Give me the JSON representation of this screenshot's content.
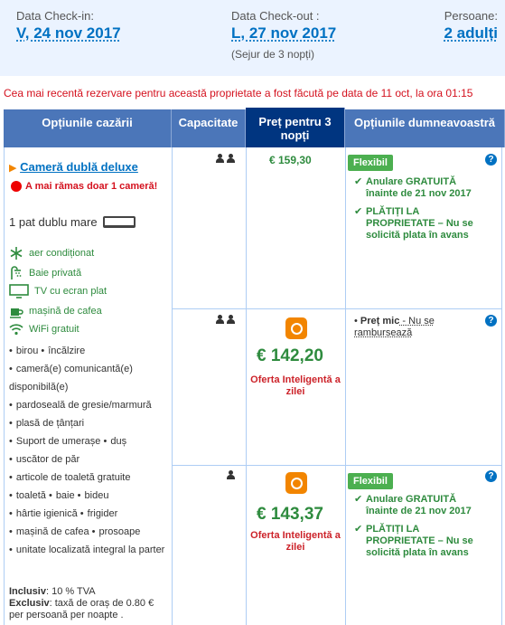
{
  "dates": {
    "checkin_label": "Data Check-in:",
    "checkin_value": "V, 24 nov 2017",
    "checkout_label": "Data Check-out :",
    "checkout_value": "L, 27 nov 2017",
    "stay_note": "(Sejur de 3 nopți)",
    "guests_label": "Persoane:",
    "guests_value": "2 adulți"
  },
  "notice": "Cea mai recentă rezervare pentru această proprietate a fost făcută pe data de 11 oct, la ora 01:15",
  "table": {
    "headers": [
      "Opțiunile cazării",
      "Capacitate",
      "Preț pentru 3 nopți",
      "Opțiunile dumneavoastră"
    ]
  },
  "room": {
    "name": "Cameră dublă deluxe",
    "alert": "A mai rămas doar 1 cameră!",
    "bed": "1 pat dublu mare",
    "amenities": [
      "aer condiționat",
      "Baie privată",
      "TV cu ecran plat",
      "mașină de cafea",
      "WiFi gratuit"
    ],
    "facilities": [
      "birou",
      "încălzire",
      "cameră(e) comunicantă(e) disponibilă(e)",
      "pardoseală de gresie/marmură",
      "plasă de țânțari",
      "Suport de umerașe",
      "duș",
      "uscător de păr",
      "articole de toaletă gratuite",
      "toaletă",
      "baie",
      "bideu",
      "hârtie igienică",
      "frigider",
      "mașină de cafea",
      "prosoape",
      "unitate localizată integral la parter"
    ],
    "included_label": "Inclusiv",
    "included_text": ": 10 % TVA",
    "excluded_label": "Exclusiv",
    "excluded_text": ": taxă de oraș de 0.80 € per persoană per noapte ."
  },
  "options": [
    {
      "persons": 2,
      "price": "€ 159,30",
      "badge": "Flexibil",
      "cond1_a": "Anulare GRATUITĂ",
      "cond1_b": "înainte de 21 nov 2017",
      "cond2_a": "PLĂTIȚI LA",
      "cond2_b": "PROPRIETATE",
      "cond2_c": " – Nu se solicită plata în avans"
    },
    {
      "persons": 2,
      "price": "€ 142,20",
      "smart": "Oferta Inteligentă a zilei",
      "low_price": "Preț mic",
      "low_price_text": " - Nu se rambursează"
    },
    {
      "persons": 1,
      "price": "€ 143,37",
      "smart": "Oferta Inteligentă a zilei",
      "badge": "Flexibil",
      "cond1_a": "Anulare GRATUITĂ",
      "cond1_b": "înainte de 21 nov 2017",
      "cond2_a": "PLĂTIȚI LA",
      "cond2_b": "PROPRIETATE",
      "cond2_c": " – Nu se solicită plata în avans"
    }
  ],
  "help_symbol": "?",
  "check_symbol": "✔",
  "colors": {
    "accent_blue": "#0071c2",
    "header_blue": "#4b76b9",
    "price_header": "#003580",
    "green": "#2e8b3e",
    "red": "#d4111e",
    "orange": "#f28500"
  }
}
